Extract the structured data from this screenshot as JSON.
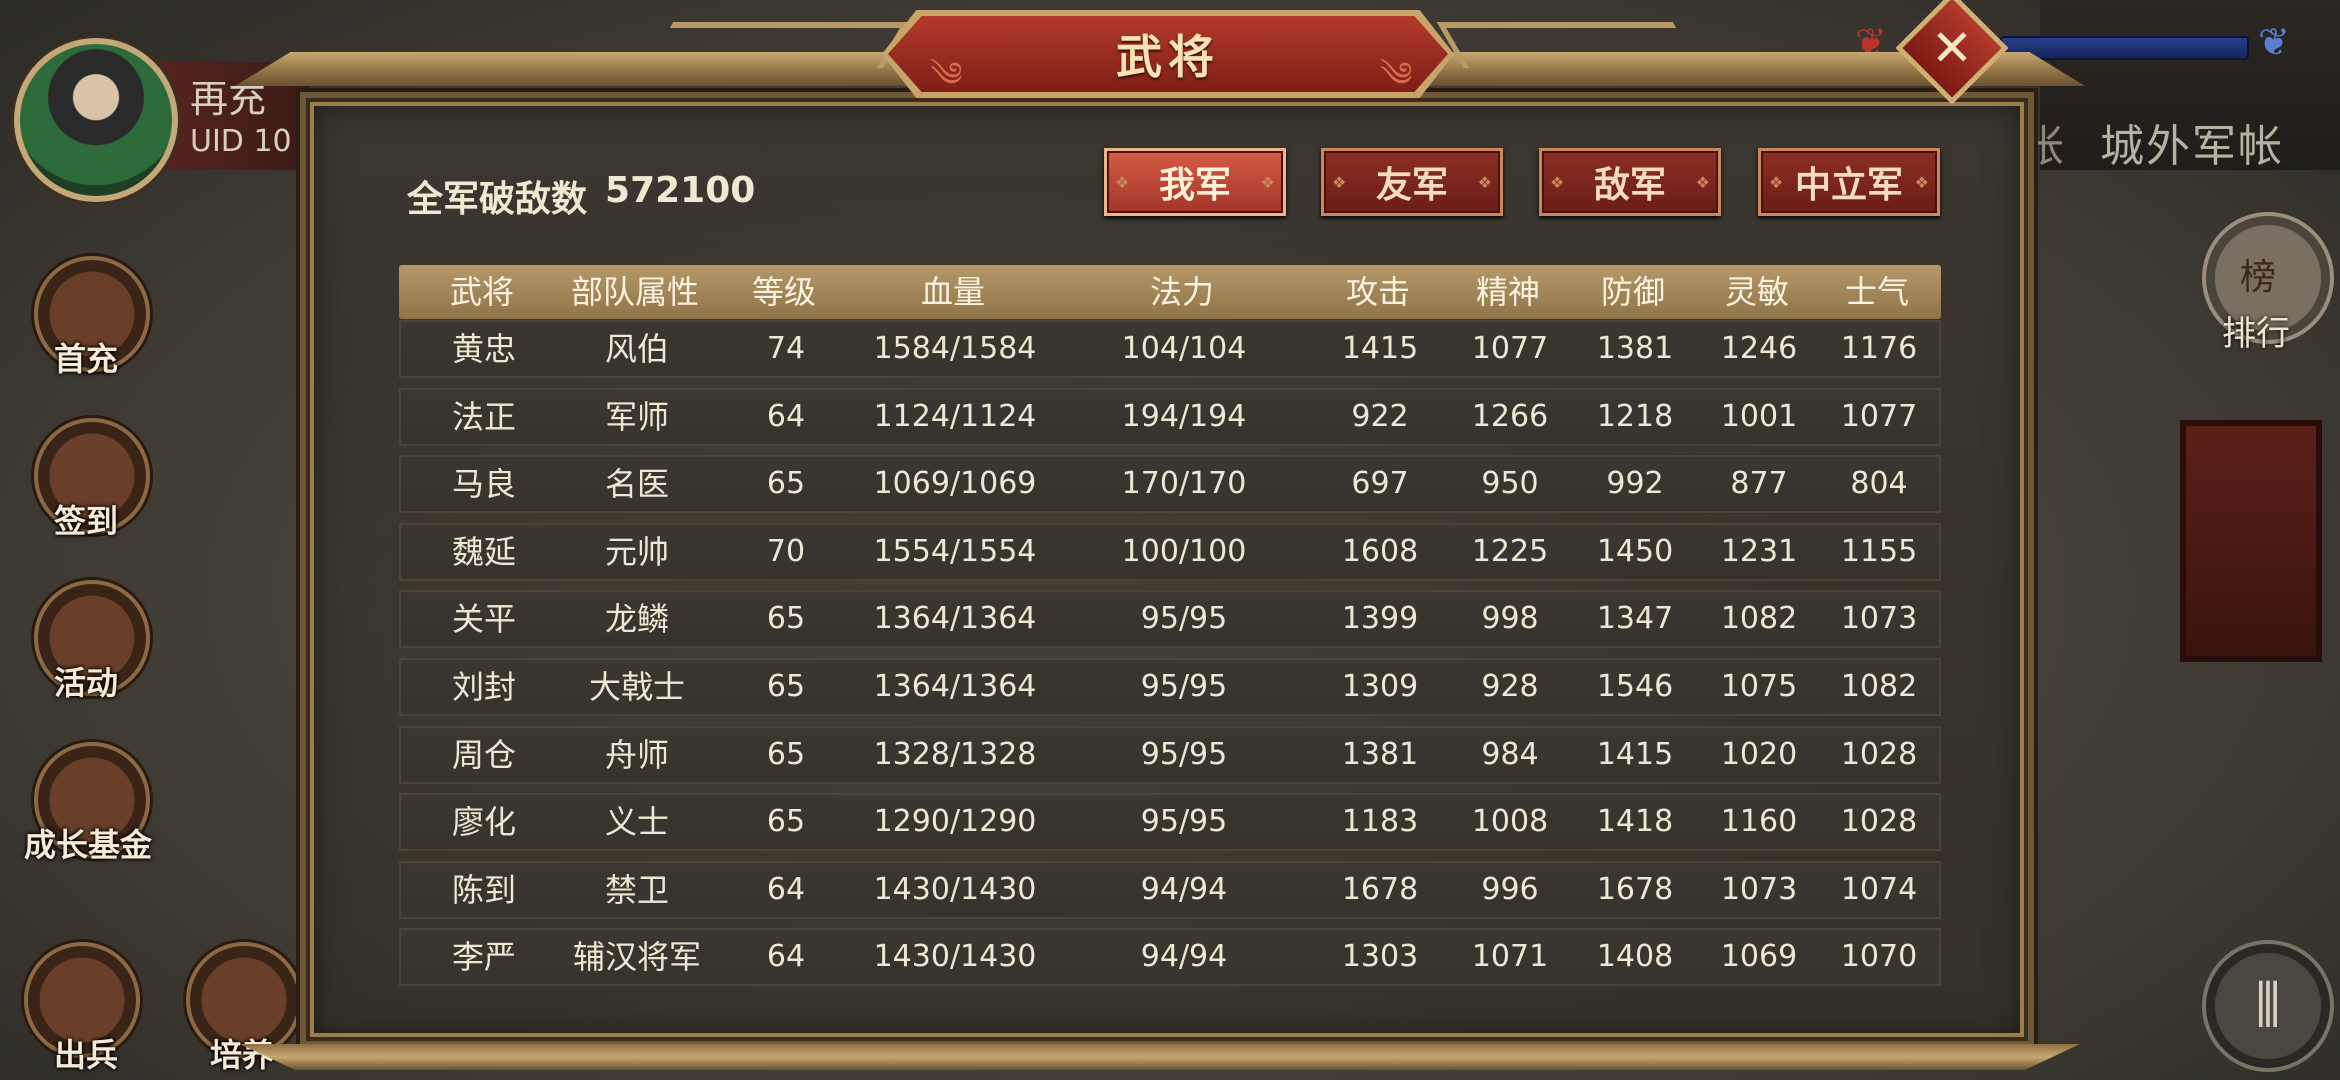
{
  "background": {
    "player_name": "再充",
    "uid_label": "UID  10",
    "right_tab_fragment": "帐",
    "right_tab_label": "城外军帐",
    "rank_glyph": "榜",
    "rank_label": "排行",
    "side_buttons": [
      {
        "label": "首充"
      },
      {
        "label": "签到"
      },
      {
        "label": "活动"
      },
      {
        "label": "成长基金"
      },
      {
        "label": "出兵"
      },
      {
        "label": "培养"
      }
    ],
    "menu_glyph": "⦀"
  },
  "dialog": {
    "title": "武将",
    "close_glyph": "✕",
    "kills_label": "全军破敌数",
    "kills_value": "572100",
    "factions": [
      {
        "label": "我军",
        "active": true
      },
      {
        "label": "友军",
        "active": false
      },
      {
        "label": "敌军",
        "active": false
      },
      {
        "label": "中立军",
        "active": false
      }
    ],
    "columns": [
      "武将",
      "部队属性",
      "等级",
      "血量",
      "法力",
      "攻击",
      "精神",
      "防御",
      "灵敏",
      "士气"
    ],
    "rows": [
      [
        "黄忠",
        "风伯",
        "74",
        "1584/1584",
        "104/104",
        "1415",
        "1077",
        "1381",
        "1246",
        "1176"
      ],
      [
        "法正",
        "军师",
        "64",
        "1124/1124",
        "194/194",
        "922",
        "1266",
        "1218",
        "1001",
        "1077"
      ],
      [
        "马良",
        "名医",
        "65",
        "1069/1069",
        "170/170",
        "697",
        "950",
        "992",
        "877",
        "804"
      ],
      [
        "魏延",
        "元帅",
        "70",
        "1554/1554",
        "100/100",
        "1608",
        "1225",
        "1450",
        "1231",
        "1155"
      ],
      [
        "关平",
        "龙鳞",
        "65",
        "1364/1364",
        "95/95",
        "1399",
        "998",
        "1347",
        "1082",
        "1073"
      ],
      [
        "刘封",
        "大戟士",
        "65",
        "1364/1364",
        "95/95",
        "1309",
        "928",
        "1546",
        "1075",
        "1082"
      ],
      [
        "周仓",
        "舟师",
        "65",
        "1328/1328",
        "95/95",
        "1381",
        "984",
        "1415",
        "1020",
        "1028"
      ],
      [
        "廖化",
        "义士",
        "65",
        "1290/1290",
        "95/95",
        "1183",
        "1008",
        "1418",
        "1160",
        "1028"
      ],
      [
        "陈到",
        "禁卫",
        "64",
        "1430/1430",
        "94/94",
        "1678",
        "996",
        "1678",
        "1073",
        "1074"
      ],
      [
        "李严",
        "辅汉将军",
        "64",
        "1430/1430",
        "94/94",
        "1303",
        "1071",
        "1408",
        "1069",
        "1070"
      ]
    ]
  },
  "colors": {
    "accent_red": "#b23a2a",
    "gold_border": "#c9a46a",
    "header_gold": "#b4986a"
  }
}
